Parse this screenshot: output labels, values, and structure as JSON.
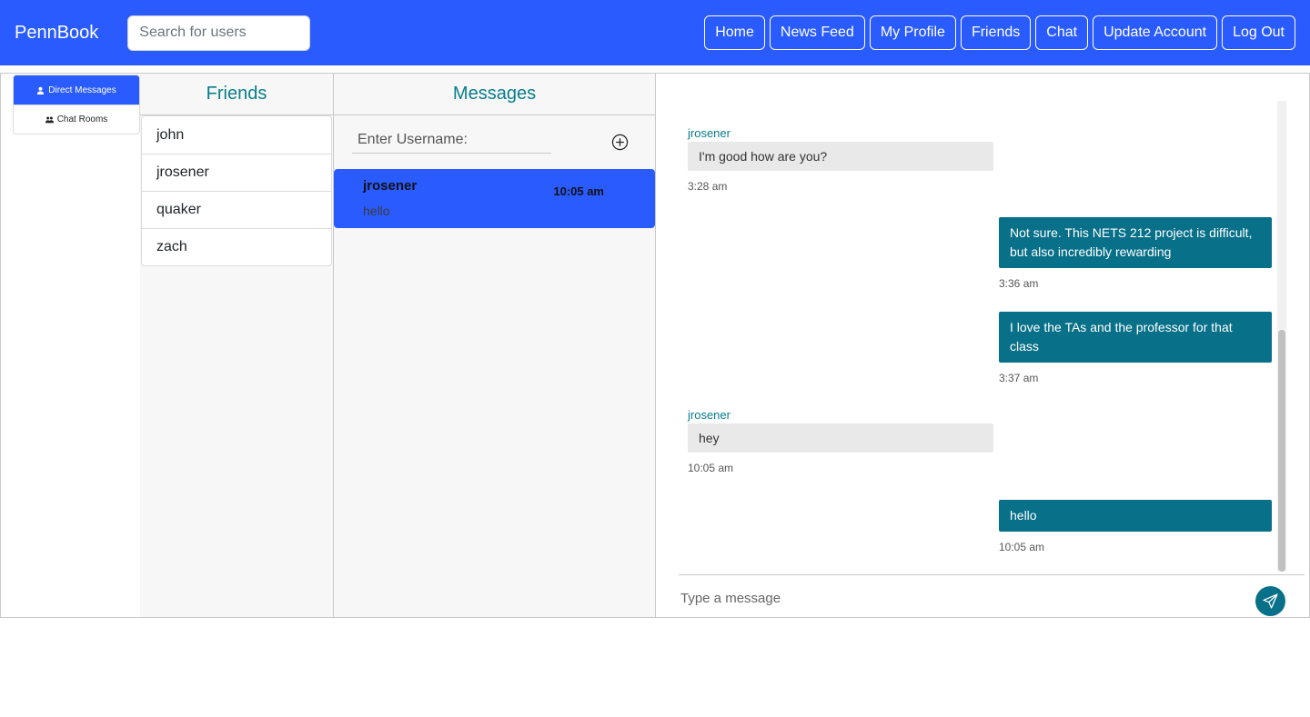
{
  "navbar": {
    "brand": "PennBook",
    "search_placeholder": "Search for users",
    "links": [
      "Home",
      "News Feed",
      "My Profile",
      "Friends",
      "Chat",
      "Update Account",
      "Log Out"
    ]
  },
  "tabs": {
    "direct_messages": "Direct Messages",
    "chat_rooms": "Chat Rooms"
  },
  "friends": {
    "title": "Friends",
    "items": [
      "john",
      "jrosener",
      "quaker",
      "zach"
    ]
  },
  "messages": {
    "title": "Messages",
    "username_placeholder": "Enter Username:",
    "conversation": {
      "name": "jrosener",
      "time": "10:05 am",
      "preview": "hello"
    }
  },
  "chat": {
    "messages": [
      {
        "from": "jrosener",
        "text": "I'm good how are you?",
        "time": "3:28 am"
      },
      {
        "text": "Not sure. This NETS 212 project is difficult, but also incredibly rewarding",
        "time": "3:36 am"
      },
      {
        "text": "I love the TAs and the professor for that class",
        "time": "3:37 am"
      },
      {
        "from": "jrosener",
        "text": "hey",
        "time": "10:05 am"
      },
      {
        "text": "hello",
        "time": "10:05 am"
      }
    ],
    "input_placeholder": "Type a message"
  },
  "colors": {
    "primary": "#2a5bff",
    "accent": "#087089",
    "title": "#087e8b"
  }
}
